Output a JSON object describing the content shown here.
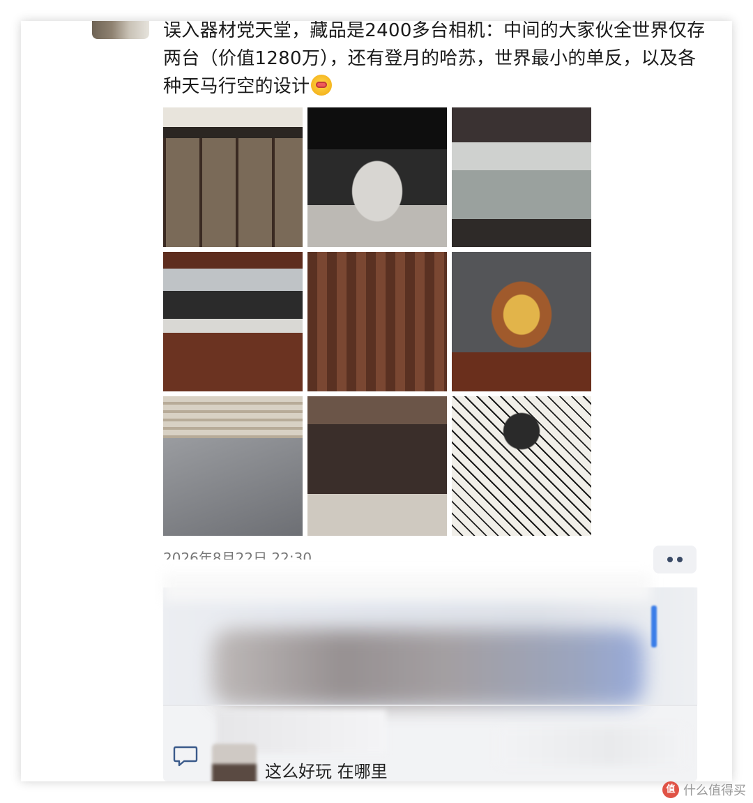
{
  "post": {
    "text": "误入器材党天堂，藏品是2400多台相机：中间的大家伙全世界仅存两台（价值1280万），还有登月的哈苏，世界最小的单反，以及各种天马行空的设计",
    "emoji": "woozy-face-icon",
    "images": [
      {
        "name": "lens-display-cabinet"
      },
      {
        "name": "exhibition-hall-stage"
      },
      {
        "name": "glass-showcase-cameras"
      },
      {
        "name": "folding-cameras-shelf"
      },
      {
        "name": "wooden-curtain-display"
      },
      {
        "name": "gold-camera-closeup"
      },
      {
        "name": "pentax-cameras-display"
      },
      {
        "name": "large-rail-camera"
      },
      {
        "name": "camera-parts-layout"
      }
    ],
    "date_partial": "2026年8月22日 22:30",
    "more_icon": "more-dots-icon"
  },
  "comments": [
    {
      "text": "这么好玩 在哪里"
    }
  ],
  "watermark": {
    "icon_text": "值",
    "text": "什么值得买"
  },
  "colors": {
    "accent": "#3a7de8",
    "more_dots": "#3a4a66",
    "panel_bg": "#f2f3f5"
  }
}
